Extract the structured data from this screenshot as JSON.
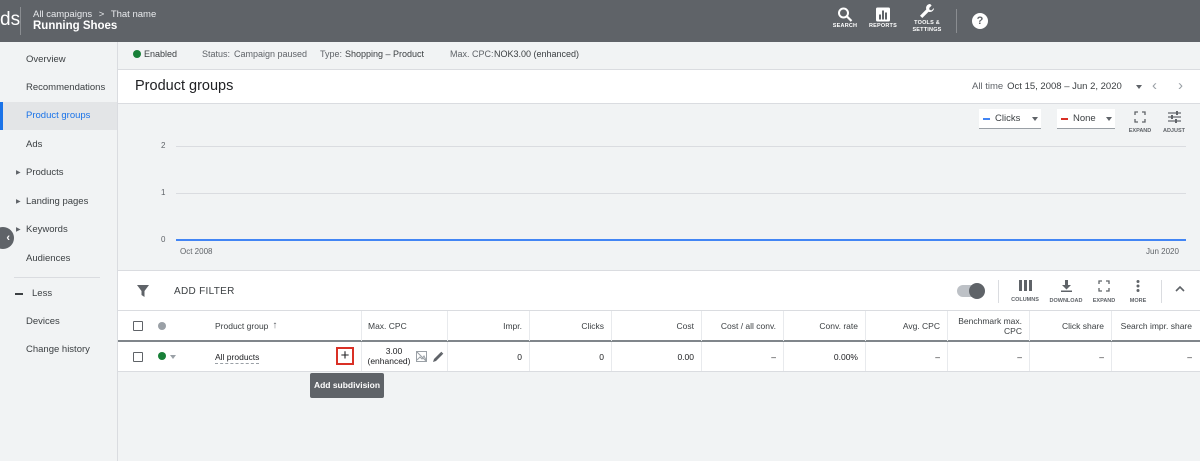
{
  "topbar": {
    "brand_fragment": "ds",
    "breadcrumb": {
      "parent": "All campaigns",
      "separator": ">",
      "current": "That name"
    },
    "campaign_name": "Running Shoes",
    "actions": [
      {
        "id": "search",
        "label": "SEARCH",
        "icon": "search-icon"
      },
      {
        "id": "reports",
        "label": "REPORTS",
        "icon": "reports-icon"
      },
      {
        "id": "tools",
        "label": "TOOLS &",
        "label2": "SETTINGS",
        "icon": "wrench-icon"
      }
    ],
    "help_glyph": "?"
  },
  "sidebar": {
    "items": [
      {
        "label": "Overview"
      },
      {
        "label": "Recommendations"
      },
      {
        "label": "Product groups",
        "active": true
      },
      {
        "label": "Ads"
      },
      {
        "label": "Products",
        "expandable": true
      },
      {
        "label": "Landing pages",
        "expandable": true
      },
      {
        "label": "Keywords",
        "expandable": true
      },
      {
        "label": "Audiences"
      }
    ],
    "less_label": "Less",
    "more_items": [
      {
        "label": "Devices"
      },
      {
        "label": "Change history"
      }
    ]
  },
  "status": {
    "enabled_label": "Enabled",
    "status_key": "Status:",
    "status_value": "Campaign paused",
    "type_key": "Type:",
    "type_value": "Shopping – Product",
    "cpc_key": "Max. CPC:",
    "cpc_value": "NOK3.00 (enhanced)",
    "enabled_color": "#188038"
  },
  "page": {
    "title": "Product groups",
    "date_prefix": "All time",
    "date_range": "Oct 15, 2008 – Jun 2, 2020"
  },
  "chart_controls": {
    "metric1": {
      "label": "Clicks",
      "color": "#4285f4"
    },
    "metric2": {
      "label": "None",
      "color": "#d93025"
    },
    "expand_label": "EXPAND",
    "adjust_label": "ADJUST"
  },
  "chart_data": {
    "type": "line",
    "x": [
      "Oct 2008",
      "Jun 2020"
    ],
    "series": [
      {
        "name": "Clicks",
        "values": [
          0,
          0
        ]
      }
    ],
    "yticks": [
      "0",
      "1",
      "2"
    ],
    "xticks": [
      "Oct 2008",
      "Jun 2020"
    ],
    "ylim": [
      0,
      2
    ],
    "grid": true,
    "title": "",
    "xlabel": "",
    "ylabel": ""
  },
  "table_toolbar": {
    "add_filter": "ADD FILTER",
    "columns": "COLUMNS",
    "download": "DOWNLOAD",
    "expand": "EXPAND",
    "more": "MORE"
  },
  "table": {
    "columns": [
      "Product group",
      "Max. CPC",
      "Impr.",
      "Clicks",
      "Cost",
      "Cost / all conv.",
      "Conv. rate",
      "Avg. CPC",
      "Benchmark max. CPC",
      "Click share",
      "Search impr. share"
    ],
    "row": {
      "product_group": "All products",
      "bid_value": "3.00",
      "bid_note": "(enhanced)",
      "impr": "0",
      "clicks": "0",
      "cost": "0.00",
      "cost_per_conv": "–",
      "conv_rate": "0.00%",
      "avg_cpc": "–",
      "benchmark": "–",
      "click_share": "–",
      "search_share": "–"
    },
    "add_subdivision_tooltip": "Add subdivision"
  }
}
